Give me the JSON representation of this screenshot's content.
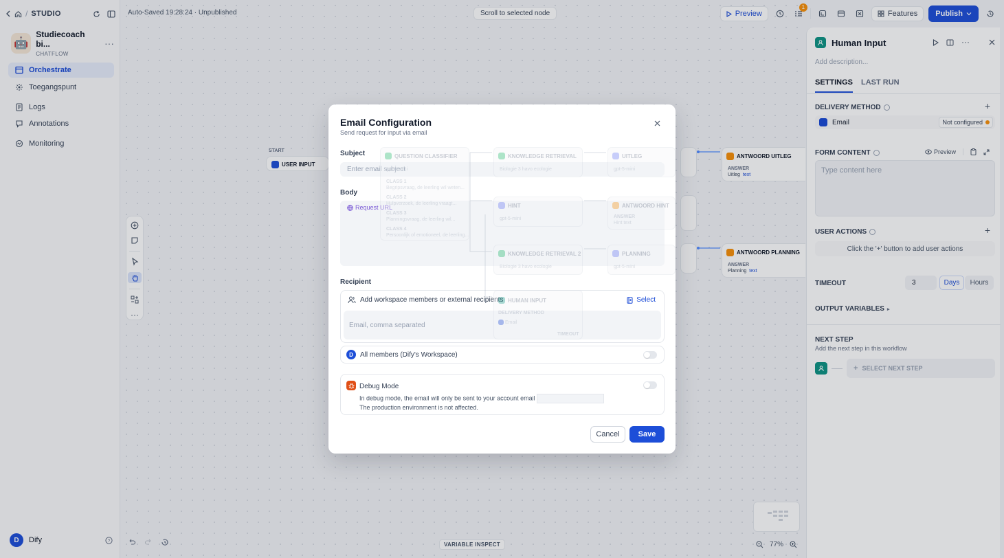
{
  "topnav": {
    "studio": "STUDIO"
  },
  "app": {
    "name": "Studiecoach bi...",
    "mode": "CHATFLOW",
    "avatar": "🤖"
  },
  "sidebar": {
    "items": [
      {
        "label": "Orchestrate",
        "icon": "orchestrate-icon",
        "active": true
      },
      {
        "label": "Toegangspunt",
        "icon": "access-point-icon"
      },
      {
        "label": "Logs",
        "icon": "logs-icon"
      },
      {
        "label": "Annotations",
        "icon": "annotations-icon"
      },
      {
        "label": "Monitoring",
        "icon": "monitoring-icon"
      }
    ],
    "user": {
      "initial": "D",
      "name": "Dify"
    }
  },
  "header": {
    "autosave": "Auto-Saved 19:28:24 · Unpublished",
    "scroll_to_node": "Scroll to selected node",
    "preview": "Preview",
    "checklist_badge": "1",
    "features": "Features",
    "publish": "Publish"
  },
  "canvas": {
    "start_label": "START",
    "user_input": "USER INPUT",
    "variable_inspect": "VARIABLE INSPECT",
    "zoom": "77%",
    "nodes": {
      "answer_uitleg": {
        "title": "ANTWOORD UITLEG",
        "label": "ANSWER",
        "var": "Uitleg",
        "type": "text"
      },
      "answer_planning": {
        "title": "ANTWOORD PLANNING",
        "label": "ANSWER",
        "var": "Planning",
        "type": "text"
      }
    },
    "ghost": {
      "question_classifier": "QUESTION CLASSIFIER",
      "model1": "gpt-5-mini",
      "class1": "CLASS 1",
      "class1_desc": "Begripsvraag, de leerling wil weten...",
      "class2": "CLASS 2",
      "class2_desc": "Hulpverzoek, de leerling vraagt...",
      "class3": "CLASS 3",
      "class3_desc": "Planningsvraag, de leerling wil...",
      "class4": "CLASS 4",
      "class4_desc": "Persoonlijk of emotioneel, de leerling...",
      "kr1": "KNOWLEDGE RETRIEVAL",
      "kr1_src": "Biologie 3 havo ecologie",
      "uitleg": "UITLEG",
      "model_uitleg": "gpt-5-mini",
      "hint": "HINT",
      "model_hint": "gpt-5-mini",
      "answer_hint": "ANTWOORD HINT",
      "answer_hint_label": "ANSWER",
      "answer_hint_var": "Hint",
      "answer_hint_type": "text",
      "kr2": "KNOWLEDGE RETRIEVAL 2",
      "kr2_src": "Biologie 3 havo ecologie",
      "planning": "PLANNING",
      "model_planning": "gpt-5-mini",
      "human_input": "HUMAN INPUT",
      "hi_method_label": "DELIVERY METHOD",
      "hi_method": "Email",
      "hi_timeout": "TIMEOUT"
    }
  },
  "panel": {
    "title": "Human Input",
    "description_placeholder": "Add description...",
    "tabs": [
      "SETTINGS",
      "LAST RUN"
    ],
    "delivery_method": {
      "label": "DELIVERY METHOD",
      "method": "Email",
      "status": "Not configured"
    },
    "form_content": {
      "label": "FORM CONTENT",
      "preview": "Preview",
      "placeholder": "Type content here"
    },
    "user_actions": {
      "label": "USER ACTIONS",
      "hint": "Click the '+' button to add user actions"
    },
    "timeout": {
      "label": "TIMEOUT",
      "value": "3",
      "units": [
        "Days",
        "Hours"
      ],
      "selected": "Days"
    },
    "output_variables": "OUTPUT VARIABLES",
    "next_step": {
      "title": "NEXT STEP",
      "subtitle": "Add the next step in this workflow",
      "select": "SELECT NEXT STEP"
    }
  },
  "modal": {
    "title": "Email Configuration",
    "subtitle": "Send request for input via email",
    "subject_label": "Subject",
    "subject_placeholder": "Enter email subject",
    "body_label": "Body",
    "request_url": "Request URL",
    "recipient_label": "Recipient",
    "recipient_hint": "Add workspace members or external recipients",
    "select": "Select",
    "email_placeholder": "Email, comma separated",
    "all_members": "All members (Dify's Workspace)",
    "workspace_initial": "D",
    "debug_title": "Debug Mode",
    "debug_text_1": "In debug mode, the email will only be sent to your account email",
    "debug_text_2": "The production environment is not affected.",
    "cancel": "Cancel",
    "save": "Save"
  },
  "colors": {
    "primary": "#1d4ed8",
    "accent_warning": "#f79009",
    "human_input": "#0e9384"
  }
}
